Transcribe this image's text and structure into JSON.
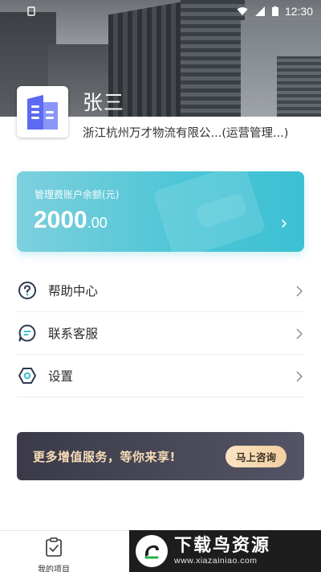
{
  "status_bar": {
    "time": "12:30"
  },
  "profile": {
    "name": "张三",
    "company": "浙江杭州万才物流有限公...(运营管理...)"
  },
  "balance_card": {
    "label": "管理费账户余额(元)",
    "amount_integer": "2000",
    "amount_decimal": ".00",
    "accent_color": "#4fc6d7"
  },
  "menu": [
    {
      "label": "帮助中心",
      "icon": "help-circle-icon"
    },
    {
      "label": "联系客服",
      "icon": "chat-bubble-icon"
    },
    {
      "label": "设置",
      "icon": "hexagon-settings-icon"
    }
  ],
  "promo": {
    "text": "更多增值服务，等你来享!",
    "button_label": "马上咨询"
  },
  "bottom_nav": {
    "items": [
      {
        "label": "我的项目",
        "icon": "clipboard-check-icon"
      }
    ]
  },
  "watermark": {
    "title": "下载鸟资源",
    "url": "www.xiazainiao.com"
  }
}
